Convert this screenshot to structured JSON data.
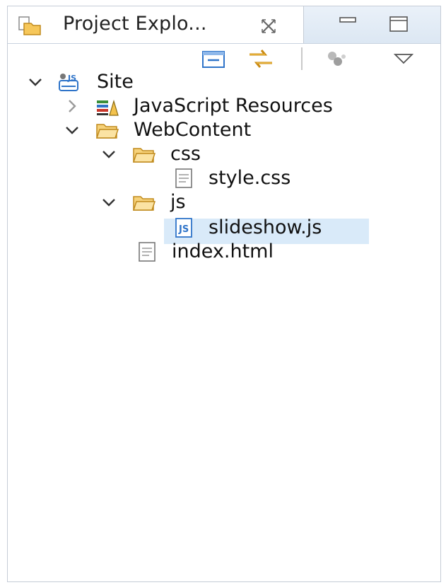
{
  "tab": {
    "title": "Project Explo...",
    "close_glyph": "⨯"
  },
  "window_controls": [
    "minimize-icon",
    "maximize-icon"
  ],
  "toolbar": {
    "buttons": [
      "collapse-all-icon",
      "link-with-editor-icon",
      "filters-icon",
      "view-menu-icon"
    ]
  },
  "tree": [
    {
      "label": "Site",
      "level": 0,
      "expanded": true,
      "icon": "js-project-icon"
    },
    {
      "label": "JavaScript Resources",
      "level": 1,
      "expanded": false,
      "icon": "library-icon"
    },
    {
      "label": "WebContent",
      "level": 1,
      "expanded": true,
      "icon": "folder-open-icon"
    },
    {
      "label": "css",
      "level": 2,
      "expanded": true,
      "icon": "folder-open-icon"
    },
    {
      "label": "style.css",
      "level": 3,
      "icon": "file-icon"
    },
    {
      "label": "js",
      "level": 2,
      "expanded": true,
      "icon": "folder-open-icon"
    },
    {
      "label": "slideshow.js",
      "level": 3,
      "icon": "js-file-icon",
      "selected": true
    },
    {
      "label": "index.html",
      "level": 2,
      "icon": "file-icon"
    }
  ],
  "colors": {
    "selection": "#d9eaf9",
    "folder": "#f3c24d",
    "accent": "#2f74c9"
  }
}
